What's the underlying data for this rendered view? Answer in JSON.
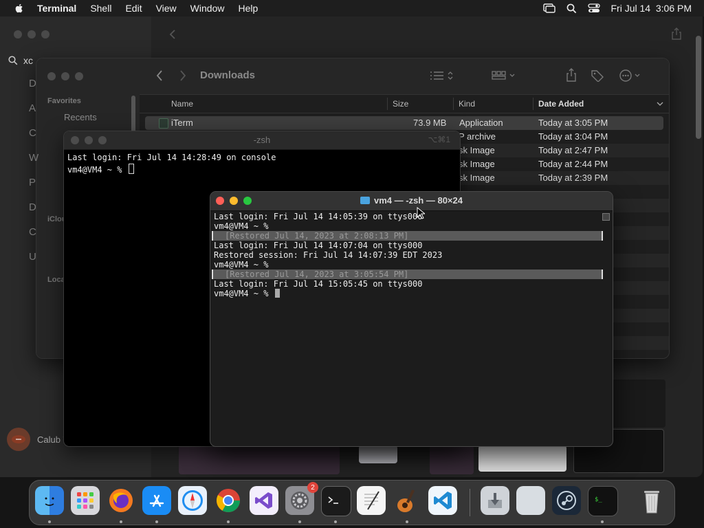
{
  "menubar": {
    "app_name": "Terminal",
    "items": [
      "Shell",
      "Edit",
      "View",
      "Window",
      "Help"
    ],
    "clock": "Fri Jul 14  3:06 PM"
  },
  "backwin": {
    "search_text": "xc",
    "side_letters": [
      "D",
      "A",
      "C",
      "W",
      "P",
      "D",
      "C",
      "U"
    ]
  },
  "account": {
    "name": "Calub Viem"
  },
  "finder": {
    "folder": "Downloads",
    "sidebar": {
      "favorites_heading": "Favorites",
      "recents": "Recents",
      "icloud_heading": "iClou",
      "locations_heading": "Loca"
    },
    "columns": {
      "name": "Name",
      "size": "Size",
      "kind": "Kind",
      "date_added": "Date Added"
    },
    "rows": [
      {
        "name": "iTerm",
        "size": "73.9 MB",
        "kind": "Application",
        "date": "Today at 3:05 PM"
      },
      {
        "name": "",
        "size": "",
        "kind": "P archive",
        "date": "Today at 3:04 PM"
      },
      {
        "name": "",
        "size": "",
        "kind": "sk Image",
        "date": "Today at 2:47 PM"
      },
      {
        "name": "",
        "size": "",
        "kind": "sk Image",
        "date": "Today at 2:44 PM"
      },
      {
        "name": "",
        "size": "",
        "kind": "sk Image",
        "date": "Today at 2:39 PM"
      }
    ]
  },
  "term1": {
    "title": "-zsh",
    "shortcut": "⌥⌘1",
    "lines": [
      "Last login: Fri Jul 14 14:28:49 on console",
      "vm4@VM4 ~ % "
    ]
  },
  "term2": {
    "title": "vm4 — -zsh — 80×24",
    "lines": [
      {
        "text": "Last login: Fri Jul 14 14:05:39 on ttys000",
        "restored": false
      },
      {
        "text": "vm4@VM4 ~ %",
        "restored": false
      },
      {
        "text": "[Restored Jul 14, 2023 at 2:08:13 PM]",
        "restored": true
      },
      {
        "text": "Last login: Fri Jul 14 14:07:04 on ttys000",
        "restored": false
      },
      {
        "text": "Restored session: Fri Jul 14 14:07:39 EDT 2023",
        "restored": false
      },
      {
        "text": "vm4@VM4 ~ %",
        "restored": false
      },
      {
        "text": "[Restored Jul 14, 2023 at 3:05:54 PM]",
        "restored": true
      },
      {
        "text": "Last login: Fri Jul 14 15:05:45 on ttys000",
        "restored": false
      },
      {
        "text": "vm4@VM4 ~ % ",
        "restored": false
      }
    ]
  },
  "dock": {
    "settings_badge": "2",
    "apps": [
      "finder",
      "launchpad",
      "firefox",
      "app-store",
      "safari",
      "chrome",
      "visual-studio",
      "system-settings",
      "terminal",
      "textedit",
      "garageband",
      "vscode",
      "installer",
      "blank-app",
      "steam",
      "iterm",
      "trash"
    ]
  }
}
